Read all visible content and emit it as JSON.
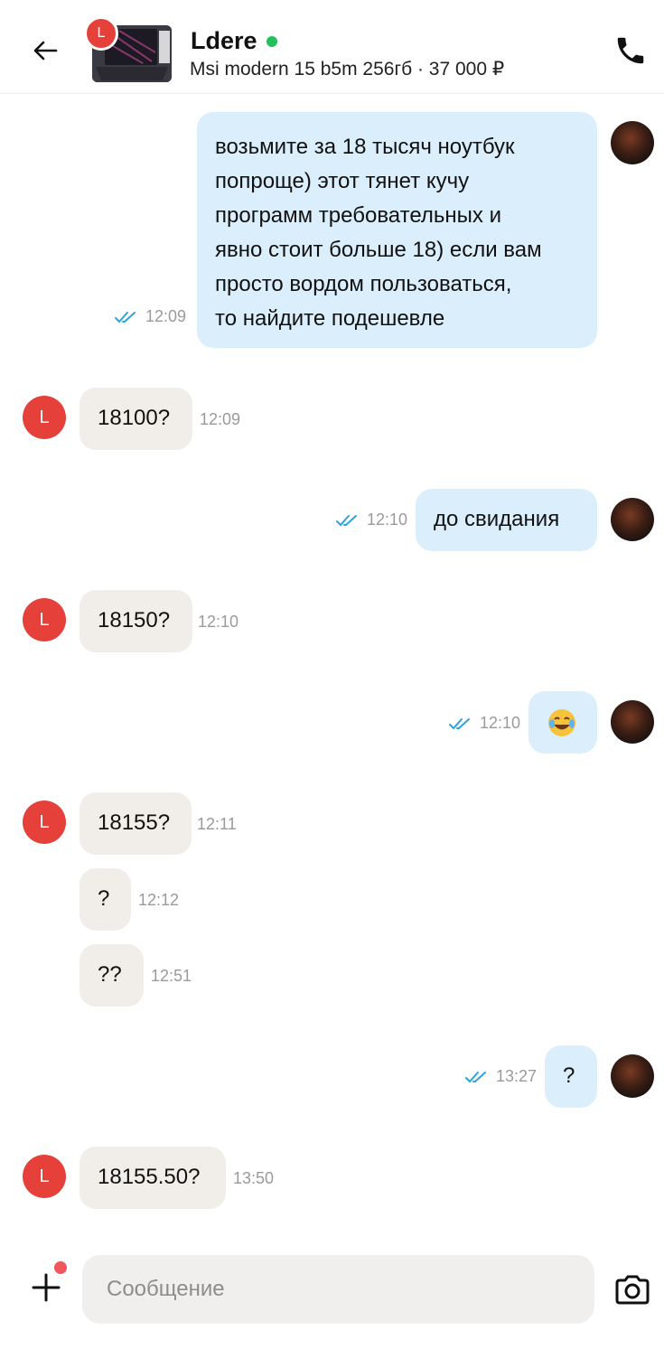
{
  "header": {
    "contact_name": "Ldere",
    "listing": "Msi modern 15 b5m 256гб · 37 000 ₽",
    "seller_initial": "L",
    "online_color": "#20c05a"
  },
  "messages": [
    {
      "dir": "out",
      "text": [
        "возьмите за 18 тысяч ноутбук",
        "попроще) этот тянет кучу",
        "программ требовательных и",
        "явно стоит больше 18) если вам",
        "просто вордом пользоваться,",
        "то найдите подешевле"
      ],
      "time": "12:09"
    },
    {
      "dir": "in",
      "text": "18100?",
      "time": "12:09",
      "initial": "L"
    },
    {
      "dir": "out",
      "text": "до свидания",
      "time": "12:10"
    },
    {
      "dir": "in",
      "text": "18150?",
      "time": "12:10",
      "initial": "L"
    },
    {
      "dir": "out",
      "text": "😂",
      "time": "12:10"
    },
    {
      "dir": "in",
      "text": "18155?",
      "time": "12:11",
      "initial": "L"
    },
    {
      "dir": "in",
      "text": "?",
      "time": "12:12"
    },
    {
      "dir": "in",
      "text": "??",
      "time": "12:51"
    },
    {
      "dir": "out",
      "text": "?",
      "time": "13:27"
    },
    {
      "dir": "in",
      "text": "18155.50?",
      "time": "13:50",
      "initial": "L"
    }
  ],
  "composer": {
    "placeholder": "Сообщение"
  },
  "colors": {
    "outgoing_bubble": "#dbeefc",
    "incoming_bubble": "#f1eee9",
    "read_ticks": "#2ba4e0",
    "avatar_red": "#e5403a"
  },
  "icons": [
    "back-arrow-icon",
    "phone-icon",
    "double-check-icon",
    "plus-icon",
    "camera-icon"
  ]
}
